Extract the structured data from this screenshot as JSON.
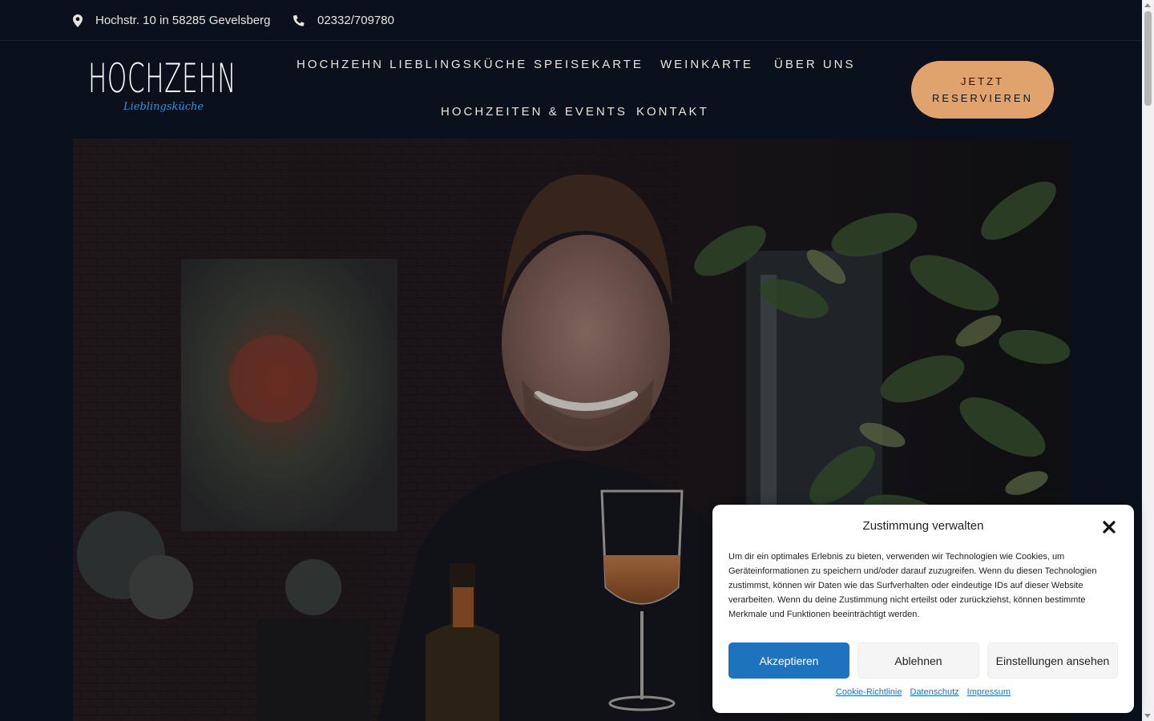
{
  "topbar": {
    "address": "Hochstr. 10 in 58285 Gevelsberg",
    "address_icon": "map-pin-icon",
    "phone": "02332/709780",
    "phone_icon": "phone-icon"
  },
  "logo": {
    "main": "HOCHZEHN",
    "sub": "Lieblingsküche"
  },
  "nav": {
    "items": [
      {
        "label": "HOCHZEHN LIEBLINGSKÜCHE"
      },
      {
        "label": "SPEISEKARTE"
      },
      {
        "label": "WEINKARTE"
      },
      {
        "label": "ÜBER UNS"
      },
      {
        "label": "HOCHZEITEN & EVENTS"
      },
      {
        "label": "KONTAKT"
      }
    ],
    "cta_line1": "JETZT",
    "cta_line2": "RESERVIEREN"
  },
  "cookie": {
    "title": "Zustimmung verwalten",
    "text": "Um dir ein optimales Erlebnis zu bieten, verwenden wir Technologien wie Cookies, um Geräteinformationen zu speichern und/oder darauf zuzugreifen. Wenn du diesen Technologien zustimmst, können wir Daten wie das Surfverhalten oder eindeutige IDs auf dieser Website verarbeiten. Wenn du deine Zustimmung nicht erteilst oder zurückziehst, können bestimmte Merkmale und Funktionen beeinträchtigt werden.",
    "accept": "Akzeptieren",
    "deny": "Ablehnen",
    "preferences": "Einstellungen ansehen",
    "links": [
      "Cookie-Richtlinie",
      "Datenschutz",
      "Impressum"
    ]
  },
  "colors": {
    "background": "#0b111c",
    "cta": "#e0a36e",
    "accent_blue": "#1e73be",
    "logo_sub": "#3a8fd8"
  }
}
